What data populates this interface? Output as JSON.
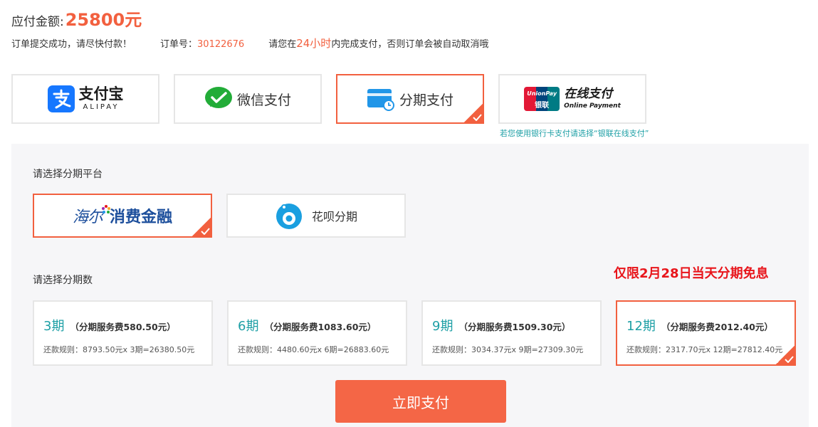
{
  "header": {
    "amount_label": "应付金额:",
    "amount_value": "25800元"
  },
  "order_info": {
    "success_text": "订单提交成功，请尽快付款！",
    "order_no_label": "订单号：",
    "order_no": "30122676",
    "deadline_prefix": "请您在",
    "deadline_hours": "24小时",
    "deadline_suffix": "内完成支付，否则订单会被自动取消哦"
  },
  "payment_methods": [
    {
      "label": "支付宝",
      "sublabel": "ALIPAY",
      "selected": false
    },
    {
      "label": "微信支付",
      "selected": false
    },
    {
      "label": "分期支付",
      "selected": true
    },
    {
      "label": "在线支付",
      "sublabel": "Online Payment",
      "logo_text": "UnionPay",
      "logo_sub": "银联",
      "selected": false
    }
  ],
  "unionpay_tip": "若您使用银行卡支付请选择“银联在线支付”",
  "installment": {
    "platform_title": "请选择分期平台",
    "platforms": [
      {
        "label_a": "海尔",
        "label_b": "消费金融",
        "selected": true
      },
      {
        "label": "花呗分期",
        "selected": false
      }
    ],
    "count_title": "请选择分期数",
    "promo": "仅限2月28日当天分期免息",
    "plans": [
      {
        "period": "3期",
        "fee": "（分期服务费580.50元）",
        "rule": "还款规则：8793.50元x 3期=26380.50元",
        "selected": false
      },
      {
        "period": "6期",
        "fee": "（分期服务费1083.60元）",
        "rule": "还款规则：4480.60元x 6期=26883.60元",
        "selected": false
      },
      {
        "period": "9期",
        "fee": "（分期服务费1509.30元）",
        "rule": "还款规则：3034.37元x 9期=27309.30元",
        "selected": false
      },
      {
        "period": "12期",
        "fee": "（分期服务费2012.40元）",
        "rule": "还款规则：2317.70元x 12期=27812.40元",
        "selected": true
      }
    ]
  },
  "pay_button": "立即支付",
  "colors": {
    "accent": "#f2603f",
    "teal": "#1fa0a6",
    "promo_red": "#e8151b",
    "alipay_blue": "#1677ff",
    "wechat_green": "#22ac38"
  }
}
